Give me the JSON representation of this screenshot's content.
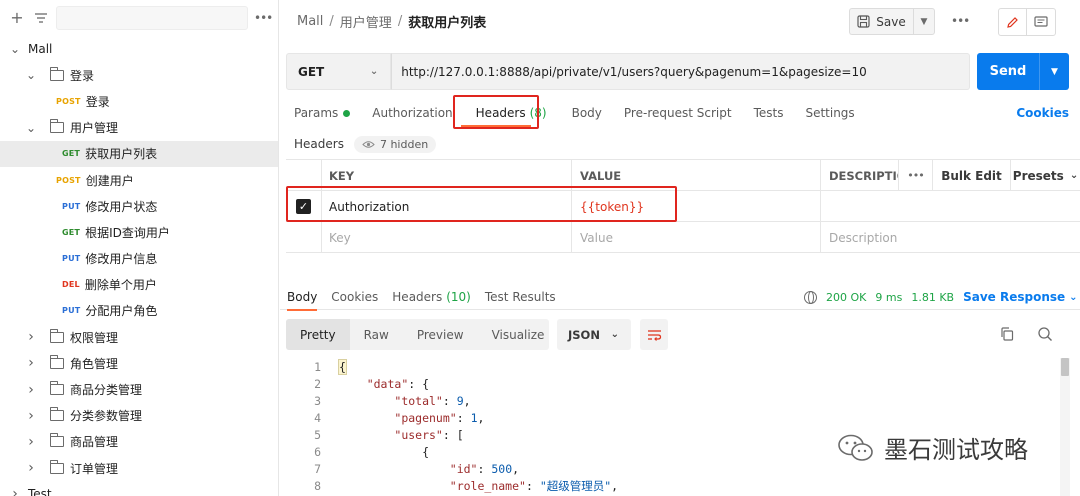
{
  "sidebar": {
    "add_icon": "plus-icon",
    "filter_icon": "filter-icon",
    "more_icon": "more-icon",
    "tree": [
      {
        "level": 0,
        "type": "collection",
        "label": "Mall",
        "expanded": true
      },
      {
        "level": 1,
        "type": "folder",
        "label": "登录",
        "expanded": true
      },
      {
        "level": 2,
        "type": "request",
        "method": "POST",
        "label": "登录"
      },
      {
        "level": 1,
        "type": "folder",
        "label": "用户管理",
        "expanded": true
      },
      {
        "level": 2,
        "type": "request",
        "method": "GET",
        "label": "获取用户列表",
        "selected": true
      },
      {
        "level": 2,
        "type": "request",
        "method": "POST",
        "label": "创建用户"
      },
      {
        "level": 2,
        "type": "request",
        "method": "PUT",
        "label": "修改用户状态"
      },
      {
        "level": 2,
        "type": "request",
        "method": "GET",
        "label": "根据ID查询用户"
      },
      {
        "level": 2,
        "type": "request",
        "method": "PUT",
        "label": "修改用户信息"
      },
      {
        "level": 2,
        "type": "request",
        "method": "DEL",
        "label": "删除单个用户"
      },
      {
        "level": 2,
        "type": "request",
        "method": "PUT",
        "label": "分配用户角色"
      },
      {
        "level": 1,
        "type": "folder",
        "label": "权限管理",
        "expanded": false
      },
      {
        "level": 1,
        "type": "folder",
        "label": "角色管理",
        "expanded": false
      },
      {
        "level": 1,
        "type": "folder",
        "label": "商品分类管理",
        "expanded": false
      },
      {
        "level": 1,
        "type": "folder",
        "label": "分类参数管理",
        "expanded": false
      },
      {
        "level": 1,
        "type": "folder",
        "label": "商品管理",
        "expanded": false
      },
      {
        "level": 1,
        "type": "folder",
        "label": "订单管理",
        "expanded": false
      },
      {
        "level": 0,
        "type": "collection",
        "label": "Test",
        "expanded": false
      }
    ]
  },
  "breadcrumb": {
    "root": "Mall",
    "sep1": "/",
    "folder": "用户管理",
    "sep2": "/",
    "current": "获取用户列表"
  },
  "toolbar": {
    "save_label": "Save",
    "more_label": "•••"
  },
  "request": {
    "method": "GET",
    "url": "http://127.0.0.1:8888/api/private/v1/users?query&pagenum=1&pagesize=10",
    "send_label": "Send"
  },
  "request_tabs": {
    "params": "Params",
    "authorization": "Authorization",
    "headers": "Headers",
    "headers_count": "(8)",
    "body": "Body",
    "prerequest": "Pre-request Script",
    "tests": "Tests",
    "settings": "Settings",
    "cookies": "Cookies"
  },
  "headers_section": {
    "title": "Headers",
    "hidden_label": "7 hidden"
  },
  "kv_table": {
    "col_key": "KEY",
    "col_value": "VALUE",
    "col_desc": "DESCRIPTIO",
    "more": "•••",
    "bulk_edit": "Bulk Edit",
    "presets": "Presets",
    "row_key": "Authorization",
    "row_value": "{{token}}",
    "ph_key": "Key",
    "ph_value": "Value",
    "ph_desc": "Description"
  },
  "response_tabs": {
    "body": "Body",
    "cookies": "Cookies",
    "headers": "Headers",
    "headers_count": "(10)",
    "test_results": "Test Results"
  },
  "response_status": {
    "status": "200 OK",
    "time": "9 ms",
    "size": "1.81 KB",
    "save_response": "Save Response"
  },
  "response_view": {
    "pretty": "Pretty",
    "raw": "Raw",
    "preview": "Preview",
    "visualize": "Visualize",
    "format": "JSON"
  },
  "code_lines": [
    {
      "n": "1",
      "text": "{"
    },
    {
      "n": "2",
      "key": "\"data\"",
      "rest": ": {",
      "indent": "    "
    },
    {
      "n": "3",
      "key": "\"total\"",
      "rest": ": ",
      "num": "9",
      "tail": ",",
      "indent": "        "
    },
    {
      "n": "4",
      "key": "\"pagenum\"",
      "rest": ": ",
      "num": "1",
      "tail": ",",
      "indent": "        "
    },
    {
      "n": "5",
      "key": "\"users\"",
      "rest": ": [",
      "indent": "        "
    },
    {
      "n": "6",
      "text": "{",
      "indent": "            "
    },
    {
      "n": "7",
      "key": "\"id\"",
      "rest": ": ",
      "num": "500",
      "tail": ",",
      "indent": "                "
    },
    {
      "n": "8",
      "key": "\"role_name\"",
      "rest": ": ",
      "str": "\"超级管理员\"",
      "tail": ",",
      "indent": "                "
    }
  ],
  "watermark": {
    "text": "墨石测试攻略"
  },
  "colors": {
    "accent": "#ff6c37",
    "send": "#097bed",
    "highlight_box": "#e0251e",
    "get": "#2e8b2e",
    "post": "#e8a300",
    "put": "#2b6fd6",
    "del": "#e0351e"
  }
}
